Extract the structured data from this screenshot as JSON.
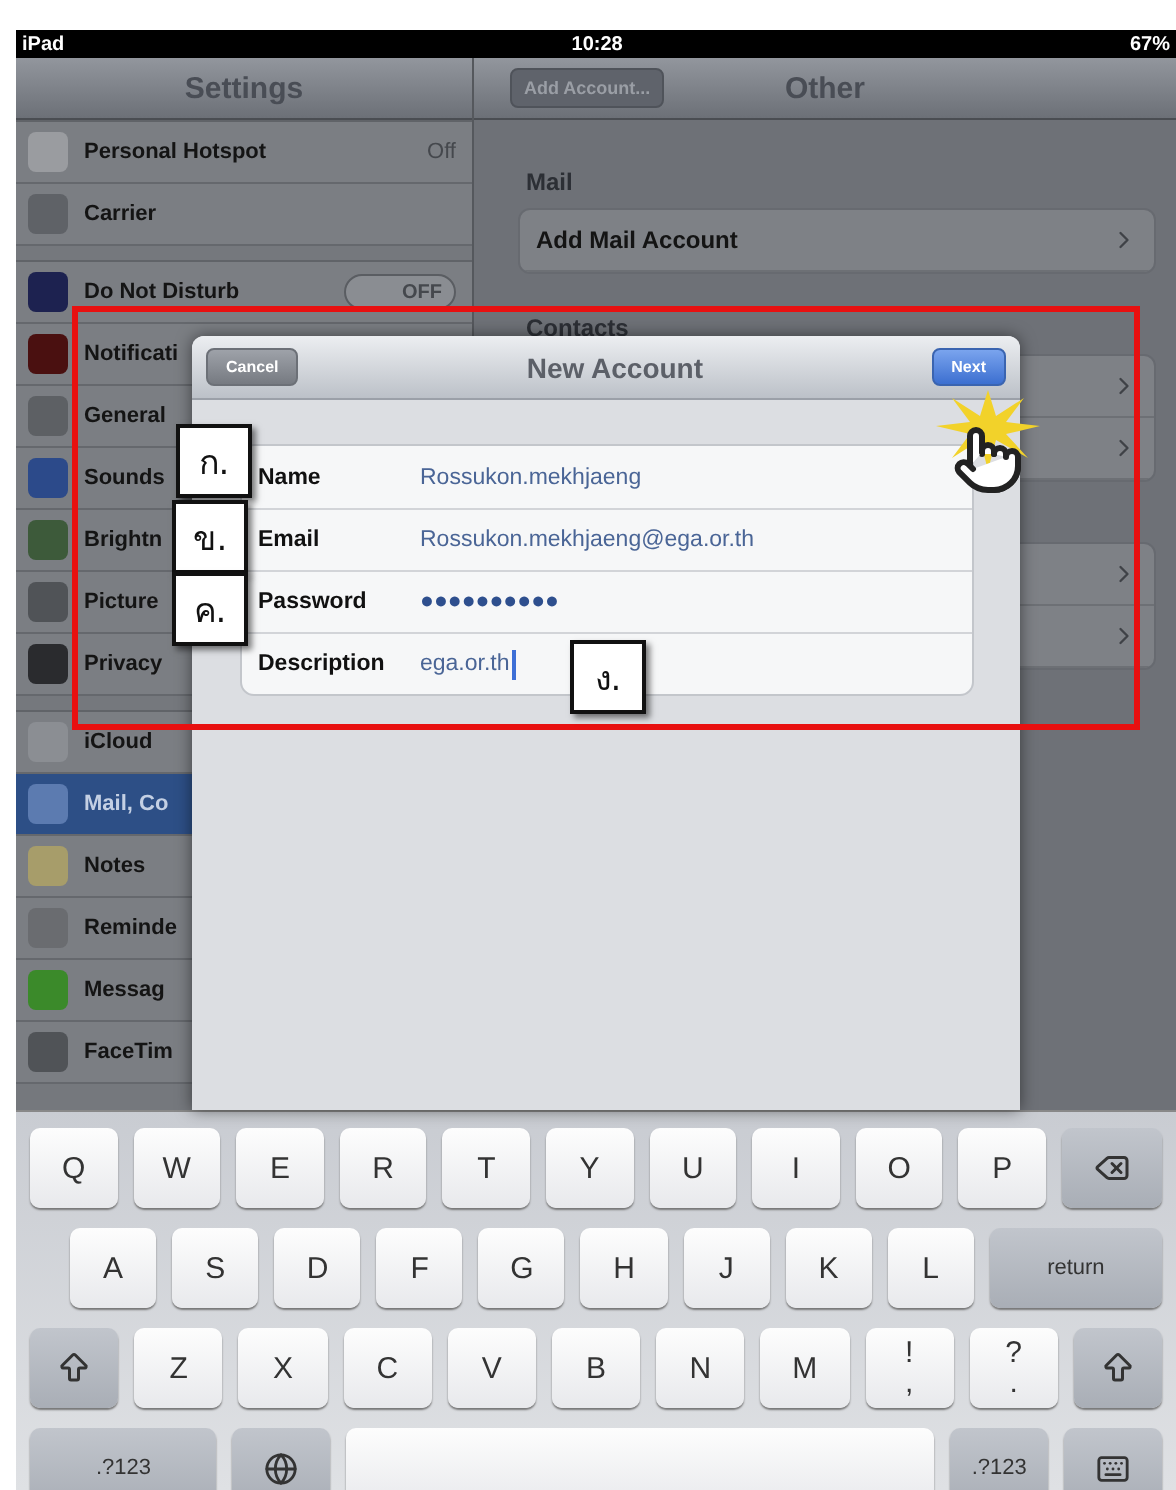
{
  "status_bar": {
    "device": "iPad",
    "time": "10:28",
    "battery": "67%"
  },
  "sidebar": {
    "title": "Settings",
    "groups": [
      {
        "items": [
          {
            "kind": "value",
            "label": "Personal Hotspot",
            "value": "Off",
            "selected": false
          },
          {
            "kind": "plain",
            "label": "Carrier",
            "selected": false
          }
        ]
      },
      {
        "items": [
          {
            "kind": "toggle",
            "label": "Do Not Disturb",
            "toggle_text": "OFF",
            "on": false,
            "selected": false
          },
          {
            "kind": "plain",
            "label": "Notificati",
            "selected": false
          },
          {
            "kind": "plain",
            "label": "General",
            "selected": false
          },
          {
            "kind": "plain",
            "label": "Sounds",
            "selected": false
          },
          {
            "kind": "plain",
            "label": "Brightn",
            "selected": false
          },
          {
            "kind": "plain",
            "label": "Picture",
            "selected": false
          },
          {
            "kind": "plain",
            "label": "Privacy",
            "selected": false
          }
        ]
      },
      {
        "items": [
          {
            "kind": "plain",
            "label": "iCloud",
            "selected": false
          },
          {
            "kind": "plain",
            "label": "Mail, Co",
            "selected": true
          },
          {
            "kind": "plain",
            "label": "Notes",
            "selected": false
          },
          {
            "kind": "plain",
            "label": "Reminde",
            "selected": false
          },
          {
            "kind": "plain",
            "label": "Messag",
            "selected": false
          },
          {
            "kind": "plain",
            "label": "FaceTim",
            "selected": false
          }
        ]
      }
    ]
  },
  "detail": {
    "back_button": "Add Account...",
    "title": "Other",
    "sections": [
      {
        "header": "Mail",
        "rows": [
          {
            "label": "Add Mail Account"
          }
        ]
      },
      {
        "header": "Contacts"
      }
    ]
  },
  "modal": {
    "title": "New Account",
    "cancel_button": "Cancel",
    "next_button": "Next",
    "fields": [
      {
        "kind": "text",
        "label": "Name",
        "value": "Rossukon.mekhjaeng",
        "focused": false
      },
      {
        "kind": "text",
        "label": "Email",
        "value": "Rossukon.mekhjaeng@ega.or.th",
        "focused": false
      },
      {
        "kind": "password",
        "label": "Password",
        "value": "●●●●●●●●●●",
        "focused": false
      },
      {
        "kind": "text",
        "label": "Description",
        "value": "ega.or.th",
        "focused": true
      }
    ]
  },
  "annotations": [
    {
      "label": "ก."
    },
    {
      "label": "ข."
    },
    {
      "label": "ค."
    },
    {
      "label": "ง."
    }
  ],
  "keyboard": {
    "rows": [
      {
        "keys": [
          {
            "kind": "char",
            "label": "Q"
          },
          {
            "kind": "char",
            "label": "W"
          },
          {
            "kind": "char",
            "label": "E"
          },
          {
            "kind": "char",
            "label": "R"
          },
          {
            "kind": "char",
            "label": "T"
          },
          {
            "kind": "char",
            "label": "Y"
          },
          {
            "kind": "char",
            "label": "U"
          },
          {
            "kind": "char",
            "label": "I"
          },
          {
            "kind": "char",
            "label": "O"
          },
          {
            "kind": "char",
            "label": "P"
          },
          {
            "kind": "delete"
          }
        ]
      },
      {
        "keys": [
          {
            "kind": "char",
            "label": "A"
          },
          {
            "kind": "char",
            "label": "S"
          },
          {
            "kind": "char",
            "label": "D"
          },
          {
            "kind": "char",
            "label": "F"
          },
          {
            "kind": "char",
            "label": "G"
          },
          {
            "kind": "char",
            "label": "H"
          },
          {
            "kind": "char",
            "label": "J"
          },
          {
            "kind": "char",
            "label": "K"
          },
          {
            "kind": "char",
            "label": "L"
          },
          {
            "kind": "return",
            "label": "return"
          }
        ]
      },
      {
        "keys": [
          {
            "kind": "shift"
          },
          {
            "kind": "char",
            "label": "Z"
          },
          {
            "kind": "char",
            "label": "X"
          },
          {
            "kind": "char",
            "label": "C"
          },
          {
            "kind": "char",
            "label": "V"
          },
          {
            "kind": "char",
            "label": "B"
          },
          {
            "kind": "char",
            "label": "N"
          },
          {
            "kind": "char",
            "label": "M"
          },
          {
            "kind": "dual",
            "top": "!",
            "bottom": ","
          },
          {
            "kind": "dual",
            "top": "?",
            "bottom": "."
          },
          {
            "kind": "shift"
          }
        ]
      },
      {
        "keys": [
          {
            "kind": "numbers",
            "label": ".?123"
          },
          {
            "kind": "globe"
          },
          {
            "kind": "space"
          },
          {
            "kind": "numbers",
            "label": ".?123"
          },
          {
            "kind": "hide"
          }
        ]
      }
    ]
  }
}
